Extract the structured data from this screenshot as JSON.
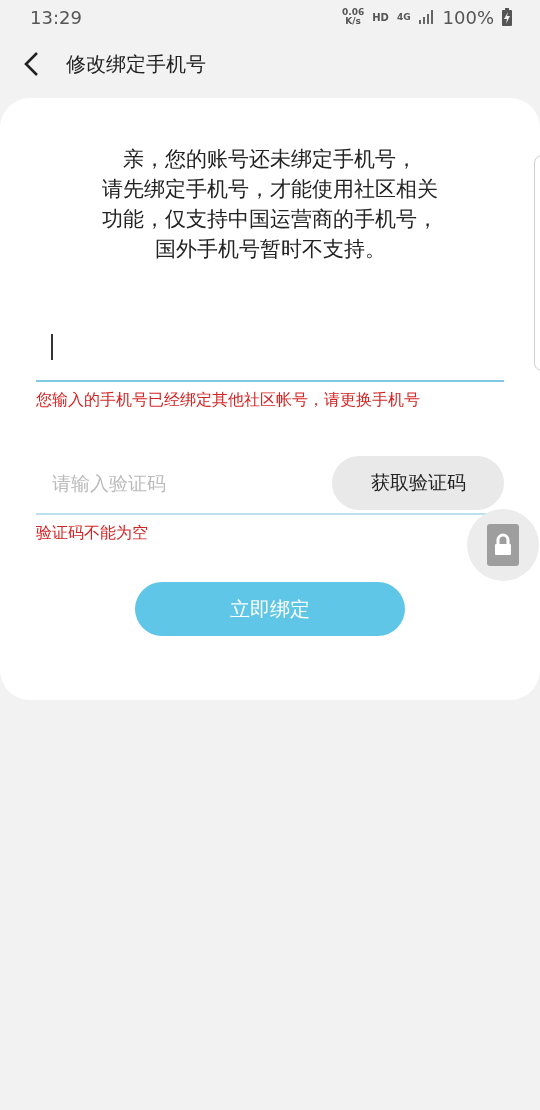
{
  "status_bar": {
    "time": "13:29",
    "net_speed_value": "0.06",
    "net_speed_unit": "K/s",
    "hd": "HD",
    "network": "4G",
    "battery": "100%",
    "charging": true
  },
  "header": {
    "title": "修改绑定手机号"
  },
  "notice_lines": [
    "亲，您的账号还未绑定手机号，",
    "请先绑定手机号，才能使用社区相关",
    "功能，仅支持中国运营商的手机号，",
    "国外手机号暂时不支持。"
  ],
  "phone_field": {
    "focused": true,
    "error": "您输入的手机号已经绑定其他社区帐号，请更换手机号"
  },
  "code_field": {
    "placeholder": "请输入验证码",
    "button": "获取验证码",
    "error": "验证码不能为空"
  },
  "submit_button": "立即绑定"
}
